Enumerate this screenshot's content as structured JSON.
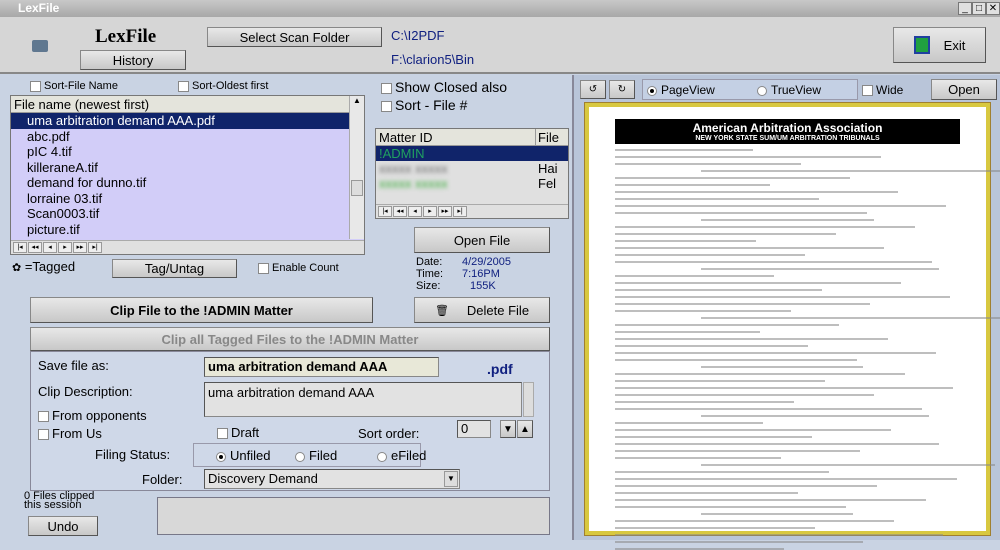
{
  "window": {
    "title": "LexFile"
  },
  "header": {
    "app_name": "LexFile",
    "history_label": "History",
    "select_scan_folder_label": "Select Scan Folder",
    "scan_folder_path": "C:\\I2PDF",
    "bin_path": "F:\\clarion5\\Bin",
    "exit_label": "Exit"
  },
  "file_list": {
    "sort_file_name_label": "Sort-File Name",
    "sort_oldest_label": "Sort-Oldest first",
    "column_header": "File name (newest first)",
    "files": [
      "uma arbitration demand AAA.pdf",
      "abc.pdf",
      "pIC 4.tif",
      "killeraneA.tif",
      "demand for dunno.tif",
      "lorraine 03.tif",
      "Scan0003.tif",
      "picture.tif"
    ]
  },
  "tagged_legend": "=Tagged",
  "tag_untag_label": "Tag/Untag",
  "enable_count_label": "Enable Count",
  "matters": {
    "show_closed_label": "Show Closed also",
    "sort_file_num_label": "Sort - File #",
    "col_matter_id": "Matter ID",
    "col_file": "File",
    "rows": [
      {
        "id": "!ADMIN",
        "file": ""
      },
      {
        "id": "",
        "file": "Hai"
      },
      {
        "id": "",
        "file": "Fel"
      }
    ]
  },
  "open_file_label": "Open File",
  "file_info": {
    "date_label": "Date:",
    "date": "4/29/2005",
    "time_label": "Time:",
    "time": "7:16PM",
    "size_label": "Size:",
    "size": "155K"
  },
  "clip_file_label": "Clip File to the !ADMIN Matter",
  "delete_file_label": "Delete File",
  "clip_all_label": "Clip all Tagged Files to the !ADMIN Matter",
  "form": {
    "save_as_label": "Save file as:",
    "save_as_value": "uma arbitration demand AAA",
    "extension": ".pdf",
    "clip_desc_label": "Clip Description:",
    "clip_desc_value": "uma arbitration demand AAA",
    "from_opponents_label": "From opponents",
    "from_us_label": "From Us",
    "draft_label": "Draft",
    "sort_order_label": "Sort order:",
    "sort_order_value": "0",
    "filing_status_label": "Filing Status:",
    "filing_options": [
      "Unfiled",
      "Filed",
      "eFiled"
    ],
    "selected_filing": "Unfiled",
    "folder_label": "Folder:",
    "folder_value": "Discovery Demand"
  },
  "footer": {
    "clipped_count": "0 Files clipped",
    "session": "this session",
    "undo_label": "Undo"
  },
  "viewer": {
    "pageview_label": "PageView",
    "trueview_label": "TrueView",
    "wide_label": "Wide",
    "open_label": "Open",
    "doc_title": "American Arbitration Association",
    "doc_subtitle": "NEW YORK STATE SUM/UM ARBITRATION TRIBUNALS"
  }
}
